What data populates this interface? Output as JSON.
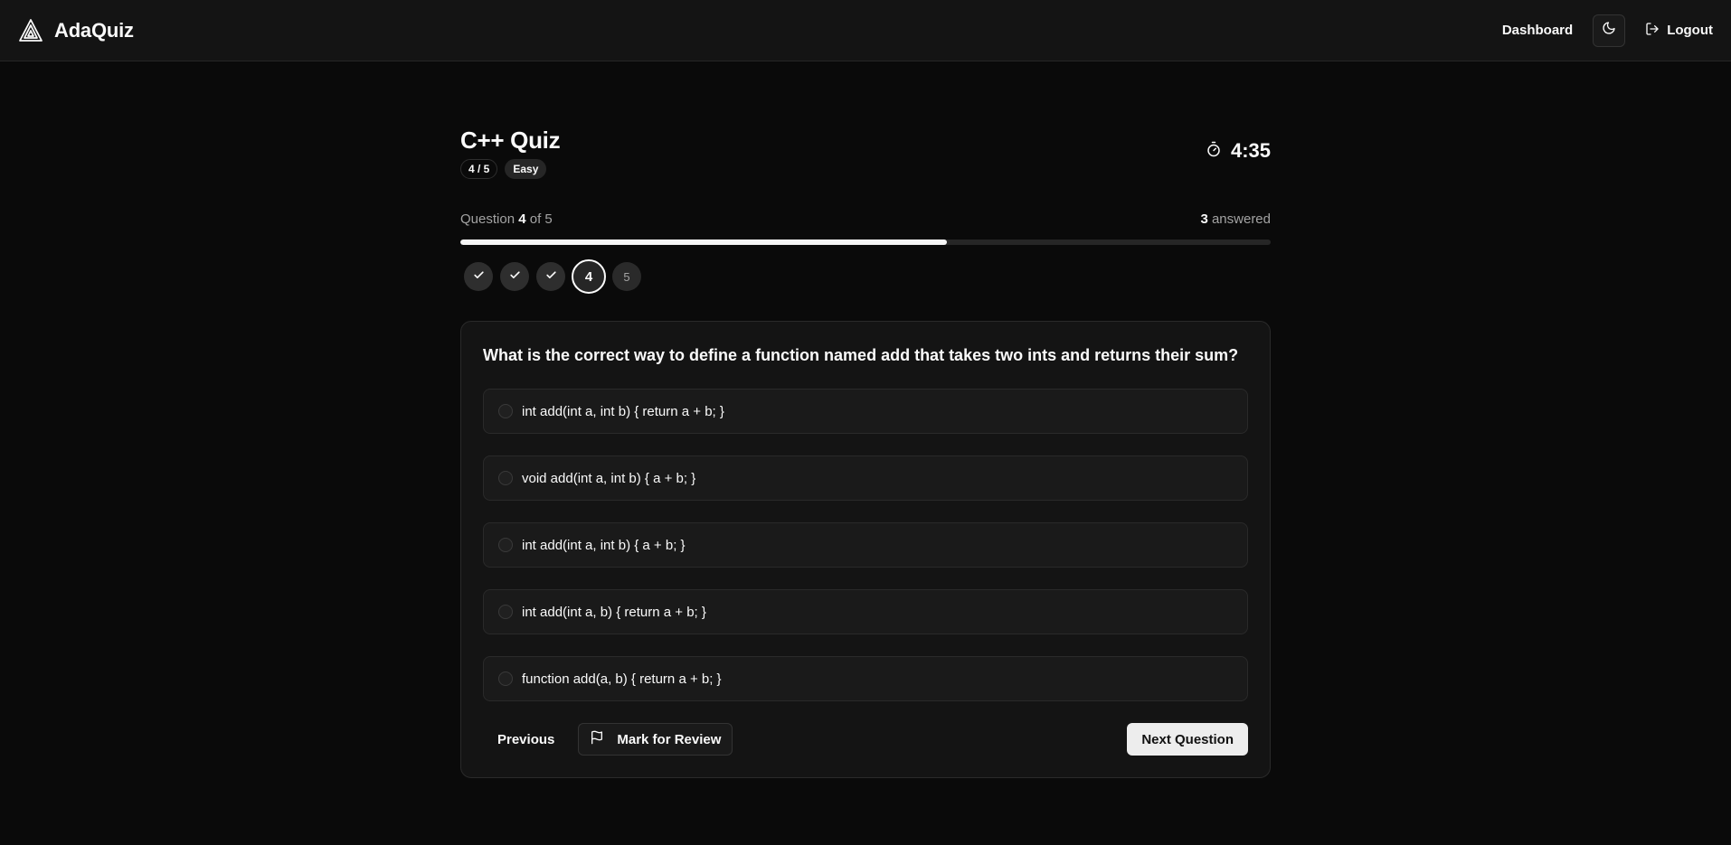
{
  "app": {
    "name": "AdaQuiz"
  },
  "nav": {
    "dashboard": "Dashboard",
    "logout": "Logout",
    "theme_icon": "moon-icon"
  },
  "quiz": {
    "title": "C++ Quiz",
    "position_badge": "4 / 5",
    "difficulty_badge": "Easy",
    "timer": "4:35"
  },
  "progress": {
    "prefix": "Question",
    "current": "4",
    "of_text": "of 5",
    "answered_count": "3",
    "answered_label": "answered",
    "fill_fraction": 0.6
  },
  "steps": [
    {
      "label": "",
      "state": "done"
    },
    {
      "label": "",
      "state": "done"
    },
    {
      "label": "",
      "state": "done"
    },
    {
      "label": "4",
      "state": "current"
    },
    {
      "label": "5",
      "state": "pending"
    }
  ],
  "question": {
    "text": "What is the correct way to define a function named add that takes two ints and returns their sum?",
    "options": [
      "int add(int a, int b) { return a + b; }",
      "void add(int a, int b) { a + b; }",
      "int add(int a, int b) { a + b; }",
      "int add(int a, b) { return a + b; }",
      "function add(a, b) { return a + b; }"
    ]
  },
  "actions": {
    "previous": "Previous",
    "mark_review": "Mark for Review",
    "next": "Next Question"
  }
}
